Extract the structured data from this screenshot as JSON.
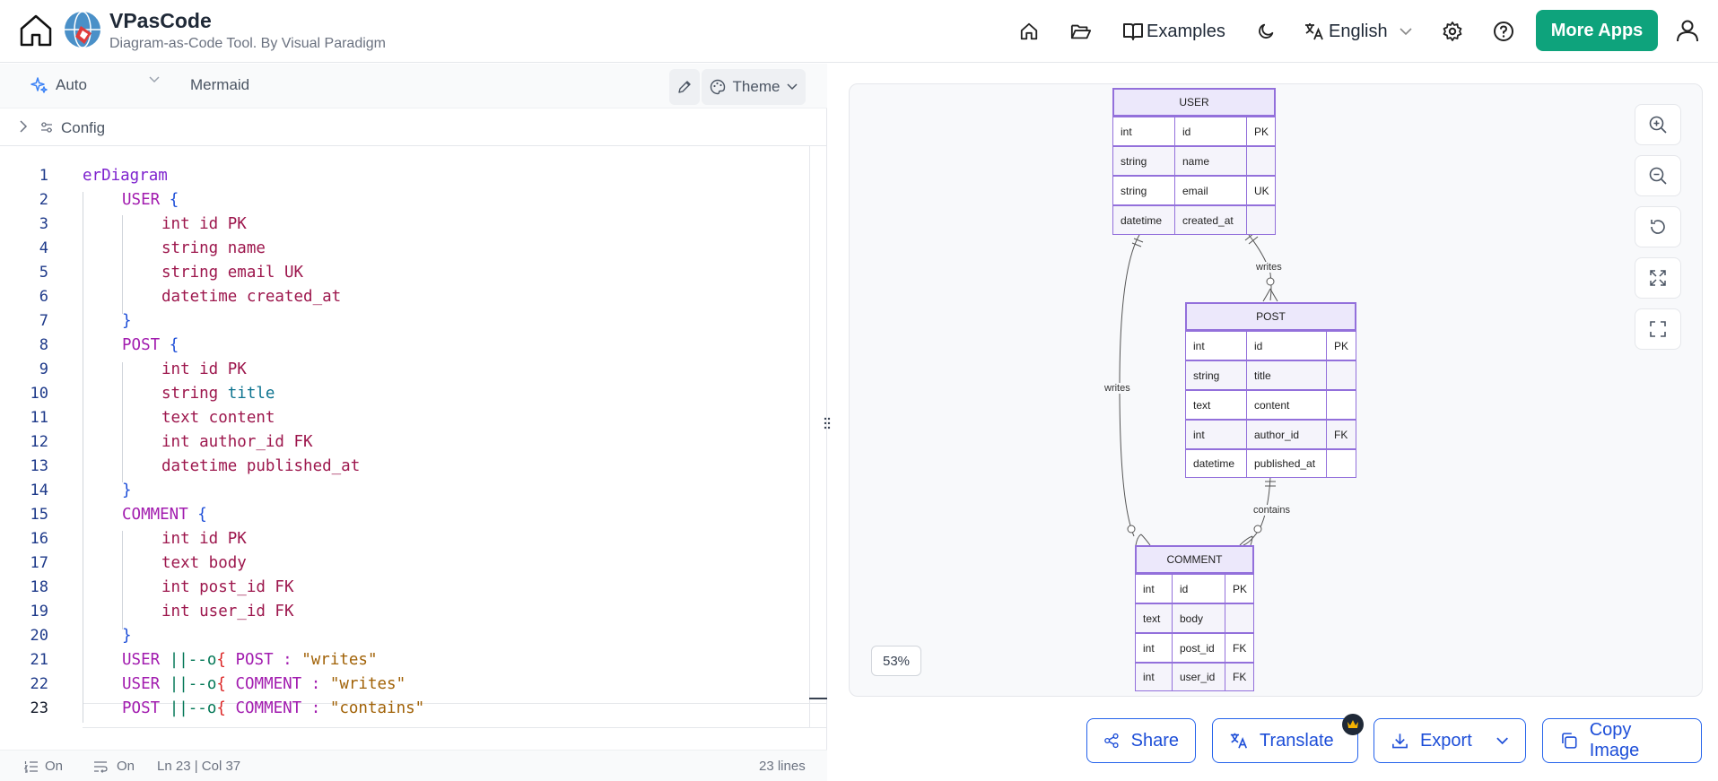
{
  "header": {
    "app_title": "VPasCode",
    "app_subtitle": "Diagram-as-Code Tool. By Visual Paradigm",
    "examples_label": "Examples",
    "language_label": "English",
    "more_apps_label": "More Apps"
  },
  "toolbar": {
    "mode_label": "Auto",
    "language_label": "Mermaid",
    "theme_label": "Theme",
    "config_label": "Config"
  },
  "editor": {
    "lines": [
      {
        "n": "1"
      },
      {
        "n": "2"
      },
      {
        "n": "3"
      },
      {
        "n": "4"
      },
      {
        "n": "5"
      },
      {
        "n": "6"
      },
      {
        "n": "7"
      },
      {
        "n": "8"
      },
      {
        "n": "9"
      },
      {
        "n": "10"
      },
      {
        "n": "11"
      },
      {
        "n": "12"
      },
      {
        "n": "13"
      },
      {
        "n": "14"
      },
      {
        "n": "15"
      },
      {
        "n": "16"
      },
      {
        "n": "17"
      },
      {
        "n": "18"
      },
      {
        "n": "19"
      },
      {
        "n": "20"
      },
      {
        "n": "21"
      },
      {
        "n": "22"
      },
      {
        "n": "23"
      }
    ],
    "code": {
      "l1": "erDiagram",
      "l2a": "USER",
      "l2b": " {",
      "l3": "int id PK",
      "l4": "string name",
      "l5": "string email UK",
      "l6": "datetime created_at",
      "l7": "}",
      "l8a": "POST",
      "l8b": " {",
      "l9": "int id PK",
      "l10a": "string ",
      "l10b": "title",
      "l11": "text content",
      "l12": "int author_id FK",
      "l13": "datetime published_at",
      "l14": "}",
      "l15a": "COMMENT",
      "l15b": " {",
      "l16": "int id PK",
      "l17": "text body",
      "l18": "int post_id FK",
      "l19": "int user_id FK",
      "l20": "}",
      "l21a": "USER ",
      "l21b": "||--o",
      "l21c": "{",
      "l21d": " POST : ",
      "l21e": "\"writes\"",
      "l22a": "USER ",
      "l22b": "||--o",
      "l22c": "{",
      "l22d": " COMMENT : ",
      "l22e": "\"writes\"",
      "l23a": "POST ",
      "l23b": "||--o",
      "l23c": "{",
      "l23d": " COMMENT : ",
      "l23e": "\"contains\""
    }
  },
  "status": {
    "line_numbers": "On",
    "word_wrap": "On",
    "cursor": "Ln 23 | Col 37",
    "line_count": "23 lines"
  },
  "preview": {
    "zoom": "53%"
  },
  "diagram": {
    "user": {
      "title": "USER",
      "rows": [
        [
          "int",
          "id",
          "PK"
        ],
        [
          "string",
          "name",
          ""
        ],
        [
          "string",
          "email",
          "UK"
        ],
        [
          "datetime",
          "created_at",
          ""
        ]
      ]
    },
    "post": {
      "title": "POST",
      "rows": [
        [
          "int",
          "id",
          "PK"
        ],
        [
          "string",
          "title",
          ""
        ],
        [
          "text",
          "content",
          ""
        ],
        [
          "int",
          "author_id",
          "FK"
        ],
        [
          "datetime",
          "published_at",
          ""
        ]
      ]
    },
    "comment": {
      "title": "COMMENT",
      "rows": [
        [
          "int",
          "id",
          "PK"
        ],
        [
          "text",
          "body",
          ""
        ],
        [
          "int",
          "post_id",
          "FK"
        ],
        [
          "int",
          "user_id",
          "FK"
        ]
      ]
    },
    "rel_user_post": "writes",
    "rel_user_comment": "writes",
    "rel_post_comment": "contains"
  },
  "actions": {
    "share_label": "Share",
    "translate_label": "Translate",
    "export_label": "Export",
    "copy_label": "Copy Image"
  }
}
